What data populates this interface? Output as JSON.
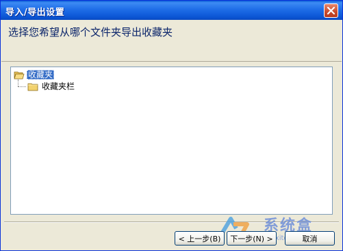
{
  "window": {
    "title": "导入/导出设置",
    "close_icon": "close-icon"
  },
  "header": {
    "prompt": "选择您希望从哪个文件夹导出收藏夹"
  },
  "tree": {
    "root": {
      "label": "收藏夹",
      "icon": "folder-open-icon",
      "selected": true
    },
    "children": [
      {
        "label": "收藏夹栏",
        "icon": "folder-icon"
      }
    ]
  },
  "buttons": {
    "back": "< 上一步(B)",
    "next": "下一步(N) >",
    "cancel": "取消"
  },
  "watermark": {
    "brand": "系统盒",
    "url": "www.xitonghe.com"
  },
  "colors": {
    "titlebar": "#0b55d4",
    "selection": "#316ac5",
    "face": "#ece9d8",
    "close": "#c94a2a"
  }
}
